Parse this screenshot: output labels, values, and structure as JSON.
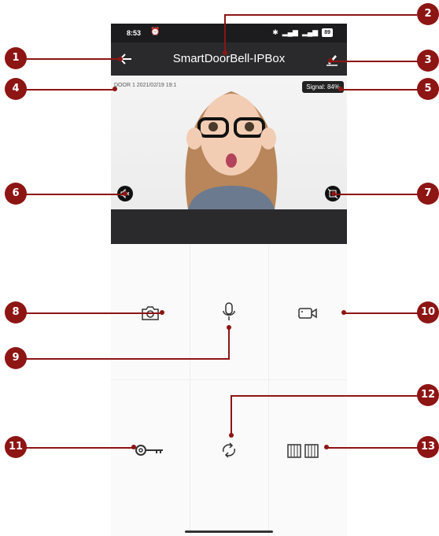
{
  "status_bar": {
    "time": "8:53",
    "battery": "89"
  },
  "app_bar": {
    "title": "SmartDoorBell-IPBox"
  },
  "video": {
    "overlay_text": "DOOR 1 2021/02/19 19:1",
    "signal_text": "Signal: 84%"
  },
  "callouts": [
    "1",
    "2",
    "3",
    "4",
    "5",
    "6",
    "7",
    "8",
    "9",
    "10",
    "11",
    "12",
    "13"
  ],
  "colors": {
    "callout": "#8d1514",
    "appbar": "#2a2a2d",
    "panel": "#fafafa"
  },
  "icons": {
    "back": "arrow-left-icon",
    "edit": "pencil-icon",
    "mute": "speaker-mute-icon",
    "fullscreen": "fullscreen-icon",
    "snapshot": "camera-icon",
    "talk": "microphone-icon",
    "record": "video-camera-icon",
    "unlock": "key-icon",
    "switch": "switch-icon",
    "gate": "gate-icon"
  }
}
